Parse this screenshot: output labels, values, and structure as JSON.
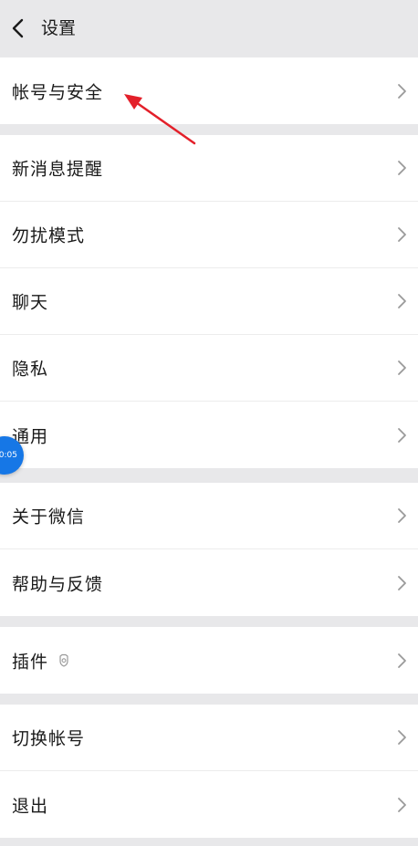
{
  "header": {
    "title": "设置",
    "back_icon": "chevron-left-icon"
  },
  "groups": [
    {
      "items": [
        {
          "label": "帐号与安全"
        }
      ]
    },
    {
      "items": [
        {
          "label": "新消息提醒"
        },
        {
          "label": "勿扰模式"
        },
        {
          "label": "聊天"
        },
        {
          "label": "隐私"
        },
        {
          "label": "通用"
        }
      ]
    },
    {
      "items": [
        {
          "label": "关于微信"
        },
        {
          "label": "帮助与反馈"
        }
      ]
    },
    {
      "items": [
        {
          "label": "插件",
          "icon": "plugin-shield-icon"
        }
      ]
    },
    {
      "items": [
        {
          "label": "切换帐号"
        },
        {
          "label": "退出"
        }
      ]
    }
  ],
  "floating_timer": {
    "text": "0:05"
  },
  "colors": {
    "background": "#e8e8ea",
    "cell": "#ffffff",
    "text": "#1a1a1a",
    "chevron": "#9a9a9a",
    "annotation_arrow": "#e3202a",
    "floating_ball": "#1677e6"
  }
}
